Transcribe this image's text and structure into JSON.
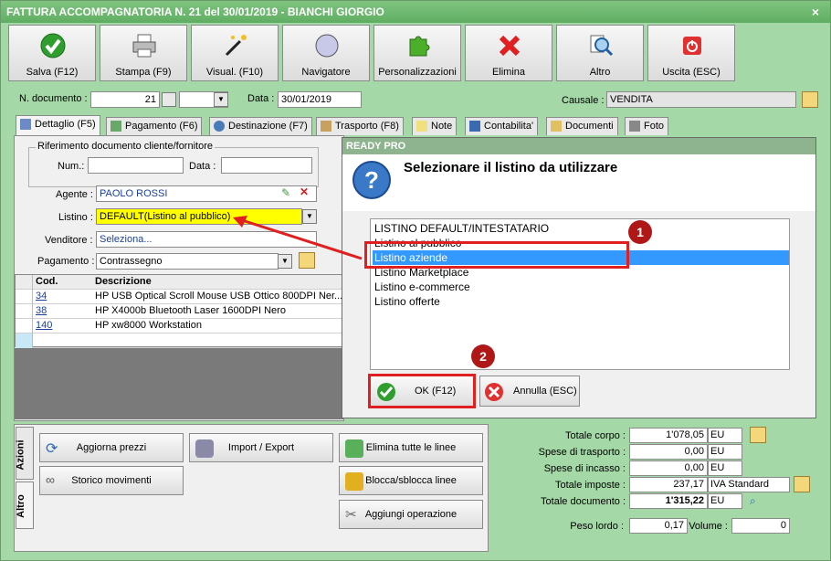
{
  "window": {
    "title": "FATTURA ACCOMPAGNATORIA N. 21 del 30/01/2019 - BIANCHI GIORGIO",
    "close": "×"
  },
  "toolbar": [
    {
      "label": "Salva (F12)",
      "icon": "check-icon"
    },
    {
      "label": "Stampa (F9)",
      "icon": "printer-icon"
    },
    {
      "label": "Visual. (F10)",
      "icon": "magic-wand-icon"
    },
    {
      "label": "Navigatore",
      "icon": "compass-icon"
    },
    {
      "label": "Personalizzazioni",
      "icon": "puzzle-icon"
    },
    {
      "label": "Elimina",
      "icon": "x-icon"
    },
    {
      "label": "Altro",
      "icon": "magnifier-icon"
    },
    {
      "label": "Uscita (ESC)",
      "icon": "power-icon"
    }
  ],
  "doc": {
    "num_label": "N. documento :",
    "num_value": "21",
    "data_label": "Data :",
    "data_value": "30/01/2019",
    "causale_label": "Causale :",
    "causale_value": "VENDITA"
  },
  "tabs": [
    "Dettaglio (F5)",
    "Pagamento (F6)",
    "Destinazione (F7)",
    "Trasporto (F8)",
    "Note",
    "Contabilita'",
    "Documenti",
    "Foto"
  ],
  "rif": {
    "group_label": "Riferimento documento cliente/fornitore",
    "num_label": "Num.:",
    "data_label": "Data :"
  },
  "fields": {
    "agente_label": "Agente :",
    "agente_value": "PAOLO ROSSI",
    "listino_label": "Listino :",
    "listino_value": "DEFAULT(Listino al pubblico)",
    "venditore_label": "Venditore :",
    "venditore_value": "Seleziona...",
    "pagamento_label": "Pagamento :",
    "pagamento_value": "Contrassegno"
  },
  "grid": {
    "headers": [
      "Cod.",
      "Descrizione"
    ],
    "rows": [
      {
        "cod": "34",
        "desc": "HP USB Optical Scroll Mouse USB Ottico 800DPI Ner..."
      },
      {
        "cod": "38",
        "desc": "HP X4000b Bluetooth Laser 1600DPI Nero"
      },
      {
        "cod": "140",
        "desc": "HP xw8000 Workstation"
      }
    ]
  },
  "dialog": {
    "title": "READY PRO",
    "heading": "Selezionare il listino da utilizzare",
    "items": [
      "LISTINO DEFAULT/INTESTATARIO",
      "Listino al pubblico",
      "Listino aziende",
      "Listino Marketplace",
      "Listino e-commerce",
      "Listino offerte"
    ],
    "selected_index": 2,
    "ok": "OK (F12)",
    "cancel": "Annulla (ESC)",
    "callout1": "1",
    "callout2": "2"
  },
  "actions": {
    "vtab1": "Azioni",
    "vtab2": "Altro",
    "aggiorna": "Aggiorna prezzi",
    "import": "Import / Export",
    "elimina_linee": "Elimina tutte le linee",
    "storico": "Storico movimenti",
    "blocca": "Blocca/sblocca linee",
    "aggiungi": "Aggiungi operazione"
  },
  "totals": [
    {
      "label": "Totale corpo :",
      "value": "1'078,05",
      "unit": "EU"
    },
    {
      "label": "Spese di trasporto :",
      "value": "0,00",
      "unit": "EU"
    },
    {
      "label": "Spese di incasso :",
      "value": "0,00",
      "unit": "EU"
    },
    {
      "label": "Totale imposte :",
      "value": "237,17",
      "unit": "IVA Standard"
    },
    {
      "label": "Totale documento :",
      "value": "1'315,22",
      "unit": "EU"
    }
  ],
  "weights": {
    "peso_label": "Peso lordo :",
    "peso_value": "0,17",
    "volume_label": "Volume :",
    "volume_value": "0"
  },
  "colors": {
    "window_bg": "#a4d8a6",
    "selection": "#3399ff",
    "highlight": "#ffff00",
    "callout": "#b01818",
    "arrow": "#e02020"
  }
}
